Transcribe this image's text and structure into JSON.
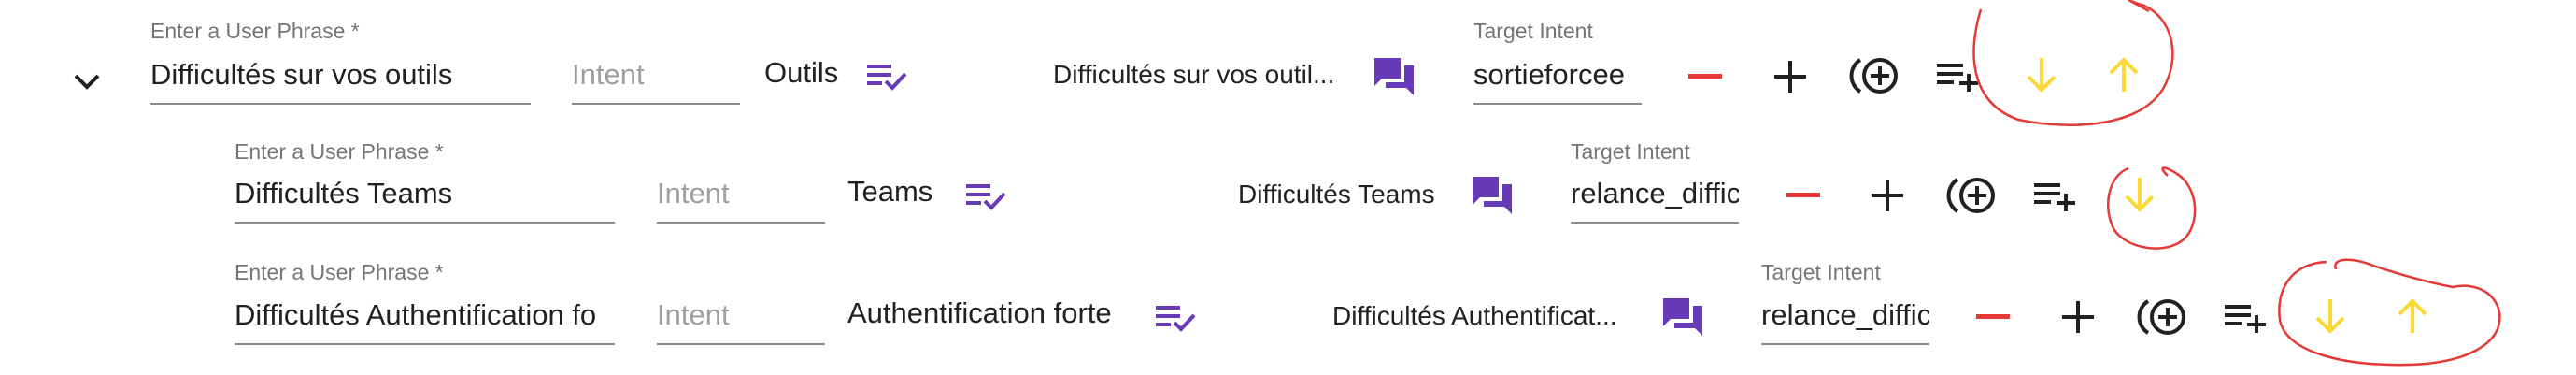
{
  "colors": {
    "accent": "#673ab7",
    "remove": "#e53935",
    "move": "#fdd835",
    "annotation": "#e53935"
  },
  "field_labels": {
    "phrase": "Enter a User Phrase *",
    "target": "Target Intent"
  },
  "rows": [
    {
      "phrase": "Difficultés sur vos outils",
      "intent_placeholder": "Intent",
      "intent_name": "Outils",
      "response_preview": "Difficultés sur vos outil...",
      "target_intent": "sortieforcee"
    },
    {
      "phrase": "Difficultés Teams",
      "intent_placeholder": "Intent",
      "intent_name": "Teams",
      "response_preview": "Difficultés Teams",
      "target_intent": "relance_diffic"
    },
    {
      "phrase": "Difficultés Authentification fo",
      "intent_placeholder": "Intent",
      "intent_name": "Authentification forte",
      "response_preview": "Difficultés Authentificat...",
      "target_intent": "relance_diffic"
    }
  ],
  "icons": {
    "collapse": "chevron-down-icon",
    "intent_list": "playlist-check-icon",
    "response": "forum-icon",
    "remove": "minus-icon",
    "add": "plus-icon",
    "add_circle": "add-circle-icon",
    "add_list": "playlist-add-icon",
    "move_down": "arrow-down-icon",
    "move_up": "arrow-up-icon"
  }
}
